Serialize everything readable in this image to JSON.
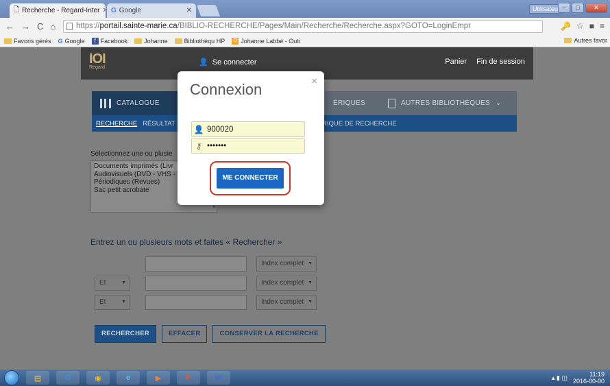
{
  "browser": {
    "tabs": [
      {
        "label": "Recherche - Regard-Inter"
      },
      {
        "label": "Google"
      }
    ],
    "user_chip": "Utilisateur",
    "url_prefix": "https://",
    "url_host": "portail.sainte-marie.ca",
    "url_path": "/BIBLIO-RECHERCHE/Pages/Main/Recherche/Recherche.aspx?GOTO=LoginEmpr",
    "bookmarks": [
      "Favoris gérés",
      "Google",
      "Facebook",
      "Johanne",
      "Bibliothèqu HP",
      "Johanne Labbé - Outi"
    ],
    "other_bookmarks": "Autres favor"
  },
  "site": {
    "logo_text": "Regard",
    "connect_label": "Se connecter",
    "cart_label": "Panier",
    "end_session_label": "Fin de session",
    "tabs": {
      "catalogue": "CATALOGUE",
      "periodiques": "ÉRIQUES",
      "autres": "AUTRES BIBLIOTHÈQUES"
    },
    "subnav": {
      "recherche": "RECHERCHE",
      "resultats": "RÉSULTAT",
      "historique": "RIQUE DE RECHERCHE"
    },
    "select_label": "Sélectionnez une ou plusie",
    "collections": [
      "Documents imprimés (Livr",
      "Audiovisuels (DVD - VHS - C",
      "Périodiques (Revues)",
      "Sac petit acrobate"
    ],
    "search_title": "Entrez un ou plusieurs mots et faites « Rechercher »",
    "operator": "Et",
    "index_label": "Index complet",
    "buttons": {
      "search": "RECHERCHER",
      "clear": "EFFACER",
      "save": "CONSERVER LA RECHERCHE"
    }
  },
  "modal": {
    "title": "Connexion",
    "close": "×",
    "username": "900020",
    "password": "•••••••",
    "submit": "ME CONNECTER"
  },
  "taskbar": {
    "time": "11:19",
    "date": "2016-00-00"
  }
}
